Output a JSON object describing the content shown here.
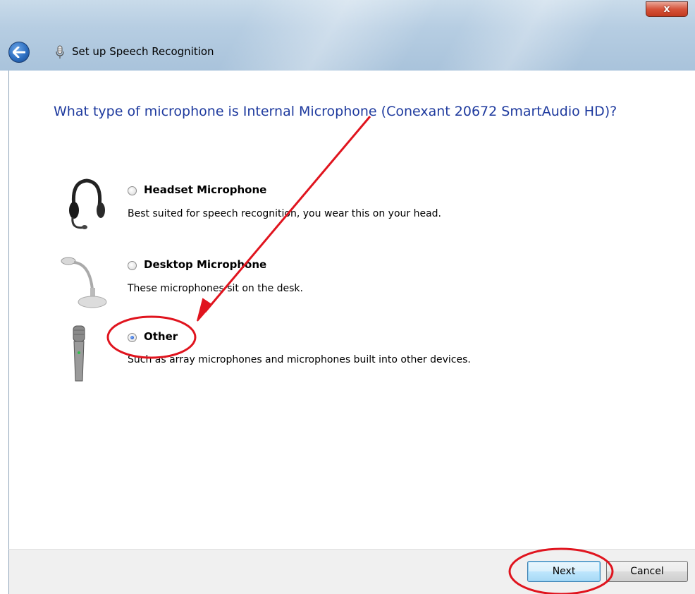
{
  "window": {
    "title": "Set up Speech Recognition",
    "close_glyph": "x"
  },
  "heading": "What type of microphone is Internal Microphone (Conexant 20672 SmartAudio HD)?",
  "options": [
    {
      "label": "Headset Microphone",
      "description": "Best suited for speech recognition, you wear this on your head.",
      "icon": "headset-icon",
      "selected": false
    },
    {
      "label": "Desktop Microphone",
      "description": "These microphones sit on the desk.",
      "icon": "desktop-microphone-icon",
      "selected": false
    },
    {
      "label": "Other",
      "description": "Such as array microphones and microphones built into other devices.",
      "icon": "handheld-microphone-icon",
      "selected": true
    }
  ],
  "buttons": {
    "next": "Next",
    "cancel": "Cancel"
  },
  "colors": {
    "heading": "#1e3a9e",
    "annotation": "#e0141e",
    "footer": "#f0f0f0"
  }
}
